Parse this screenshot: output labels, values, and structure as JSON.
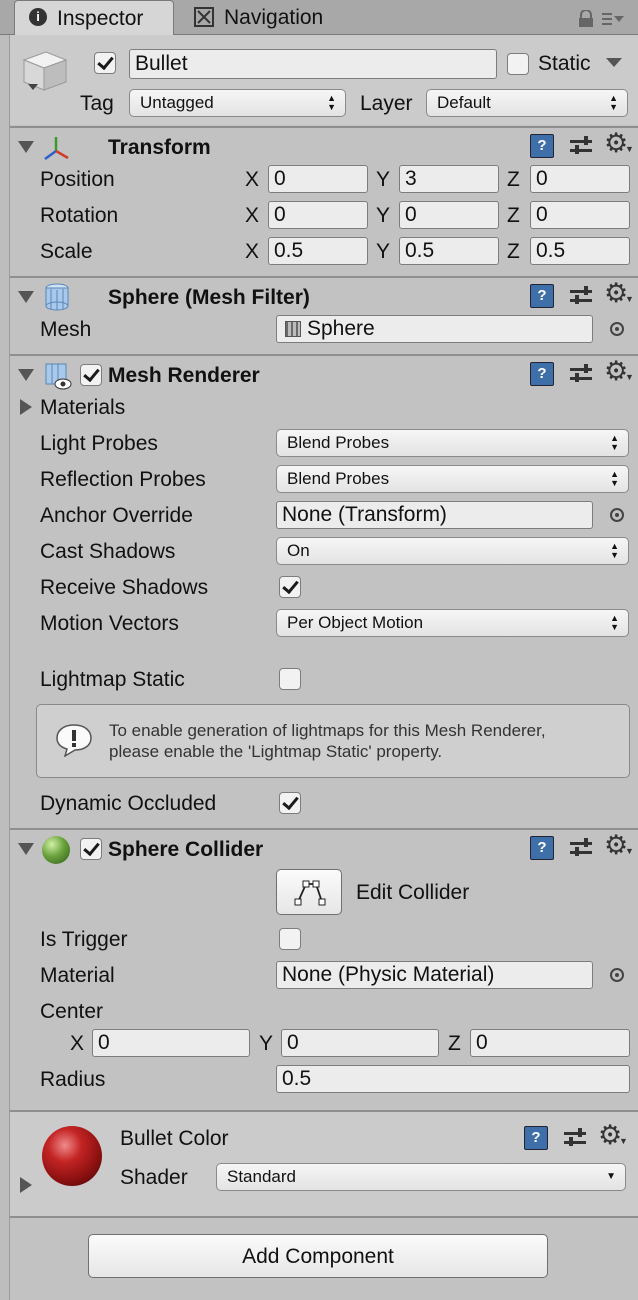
{
  "tabs": {
    "inspector": "Inspector",
    "navigation": "Navigation"
  },
  "object": {
    "active": true,
    "name": "Bullet",
    "static_checked": false,
    "static_label": "Static",
    "tag_label": "Tag",
    "tag_value": "Untagged",
    "layer_label": "Layer",
    "layer_value": "Default"
  },
  "transform": {
    "title": "Transform",
    "position": {
      "label": "Position",
      "x": "0",
      "y": "3",
      "z": "0"
    },
    "rotation": {
      "label": "Rotation",
      "x": "0",
      "y": "0",
      "z": "0"
    },
    "scale": {
      "label": "Scale",
      "x": "0.5",
      "y": "0.5",
      "z": "0.5"
    },
    "axis_x": "X",
    "axis_y": "Y",
    "axis_z": "Z"
  },
  "mesh_filter": {
    "title": "Sphere (Mesh Filter)",
    "mesh_label": "Mesh",
    "mesh_value": "Sphere"
  },
  "mesh_renderer": {
    "title": "Mesh Renderer",
    "enabled": true,
    "materials_label": "Materials",
    "light_probes_label": "Light Probes",
    "light_probes_value": "Blend Probes",
    "reflection_probes_label": "Reflection Probes",
    "reflection_probes_value": "Blend Probes",
    "anchor_override_label": "Anchor Override",
    "anchor_override_value": "None (Transform)",
    "cast_shadows_label": "Cast Shadows",
    "cast_shadows_value": "On",
    "receive_shadows_label": "Receive Shadows",
    "receive_shadows_checked": true,
    "motion_vectors_label": "Motion Vectors",
    "motion_vectors_value": "Per Object Motion",
    "lightmap_static_label": "Lightmap Static",
    "lightmap_static_checked": false,
    "info_line1": "To enable generation of lightmaps for this Mesh Renderer,",
    "info_line2": "please enable the 'Lightmap Static' property.",
    "dynamic_occluded_label": "Dynamic Occluded",
    "dynamic_occluded_checked": true
  },
  "sphere_collider": {
    "title": "Sphere Collider",
    "enabled": true,
    "edit_collider_label": "Edit Collider",
    "is_trigger_label": "Is Trigger",
    "is_trigger_checked": false,
    "material_label": "Material",
    "material_value": "None (Physic Material)",
    "center_label": "Center",
    "center_x": "0",
    "center_y": "0",
    "center_z": "0",
    "axis_x": "X",
    "axis_y": "Y",
    "axis_z": "Z",
    "radius_label": "Radius",
    "radius_value": "0.5"
  },
  "material": {
    "name": "Bullet Color",
    "shader_label": "Shader",
    "shader_value": "Standard"
  },
  "add_component_label": "Add Component",
  "icons": {
    "inspector_tab": "info-icon",
    "navigation_tab": "navigation-icon",
    "lock": "lock-icon",
    "help": "help-book-icon",
    "presets": "presets-icon",
    "settings": "gear-icon"
  },
  "colors": {
    "panel_bg": "#c2c2c2",
    "tab_active": "#d6d6d6",
    "help_icon": "#3f6fa8",
    "sphere_green": "#4f8a2e",
    "material_red": "#b01c1c"
  }
}
